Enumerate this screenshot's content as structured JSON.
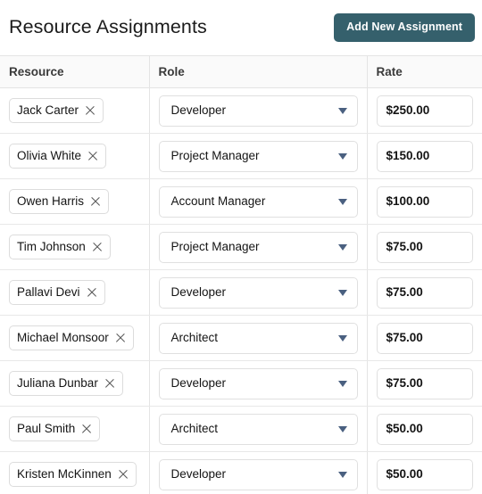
{
  "header": {
    "title": "Resource Assignments",
    "add_button_label": "Add New Assignment",
    "accent_color": "#35606c"
  },
  "table": {
    "columns": [
      {
        "key": "resource",
        "label": "Resource"
      },
      {
        "key": "role",
        "label": "Role"
      },
      {
        "key": "rate",
        "label": "Rate"
      }
    ],
    "remove_icon": "close-icon",
    "dropdown_icon": "chevron-down-icon",
    "dropdown_icon_color": "#4a6080",
    "rows": [
      {
        "resource": "Jack Carter",
        "role": "Developer",
        "rate": "$250.00"
      },
      {
        "resource": "Olivia White",
        "role": "Project Manager",
        "rate": "$150.00"
      },
      {
        "resource": "Owen Harris",
        "role": "Account Manager",
        "rate": "$100.00"
      },
      {
        "resource": "Tim Johnson",
        "role": "Project Manager",
        "rate": "$75.00"
      },
      {
        "resource": "Pallavi Devi",
        "role": "Developer",
        "rate": "$75.00"
      },
      {
        "resource": "Michael Monsoor",
        "role": "Architect",
        "rate": "$75.00"
      },
      {
        "resource": "Juliana Dunbar",
        "role": "Developer",
        "rate": "$75.00"
      },
      {
        "resource": "Paul Smith",
        "role": "Architect",
        "rate": "$50.00"
      },
      {
        "resource": "Kristen McKinnen",
        "role": "Developer",
        "rate": "$50.00"
      }
    ]
  }
}
